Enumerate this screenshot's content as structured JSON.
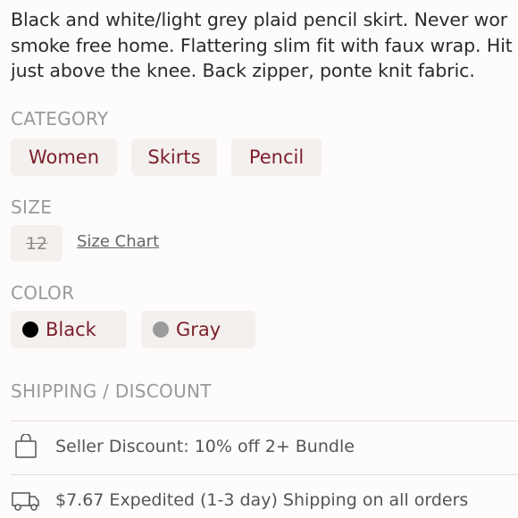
{
  "description": {
    "lines": [
      "Black and white/light grey plaid pencil skirt. Never wor",
      "smoke free home. Flattering slim fit with faux wrap. Hit",
      "just above the knee. Back zipper, ponte knit fabric."
    ]
  },
  "category": {
    "label": "CATEGORY",
    "chips": [
      "Women",
      "Skirts",
      "Pencil"
    ]
  },
  "size": {
    "label": "SIZE",
    "value": "12",
    "chart_link": "Size Chart"
  },
  "color": {
    "label": "COLOR",
    "options": [
      {
        "name": "Black",
        "swatch": "#000000"
      },
      {
        "name": "Gray",
        "swatch": "#9b9b9b"
      }
    ]
  },
  "shipping": {
    "label": "SHIPPING / DISCOUNT",
    "items": [
      {
        "icon": "shopping-bag-icon",
        "text": "Seller Discount: 10% off 2+ Bundle"
      },
      {
        "icon": "delivery-truck-icon",
        "text": "$7.67 Expedited (1-3 day) Shipping on all orders"
      }
    ]
  },
  "colors": {
    "accent": "#7a1f2b",
    "chip_bg": "#f4f0ed",
    "label_gray": "#9a9a9a"
  }
}
